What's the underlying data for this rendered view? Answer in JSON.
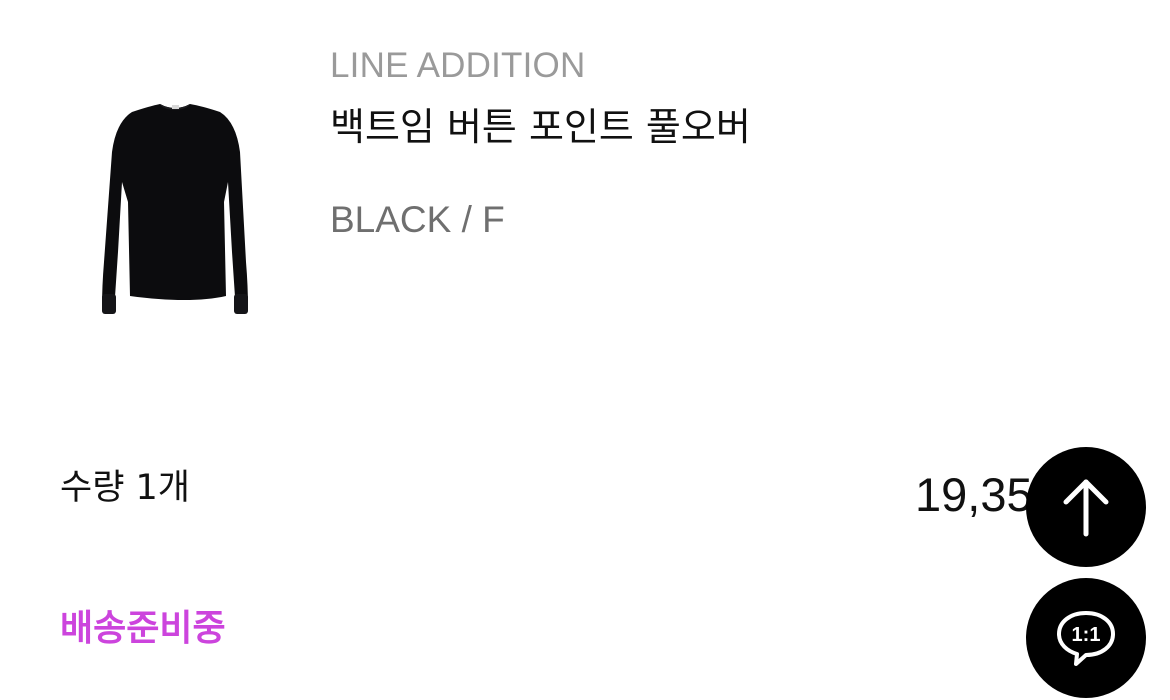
{
  "product": {
    "brand": "LINE ADDITION",
    "name": "백트임 버튼 포인트 풀오버",
    "option": "BLACK / F",
    "image_icon": "black-pullover-image"
  },
  "order": {
    "quantity_text": "수량 1개",
    "price_text": "19,35",
    "status": "배송준비중",
    "status_color": "#cc44dd"
  },
  "floating_buttons": {
    "scroll_top_icon": "arrow-up-icon",
    "chat_icon": "chat-bubble-icon",
    "chat_label": "1:1"
  }
}
